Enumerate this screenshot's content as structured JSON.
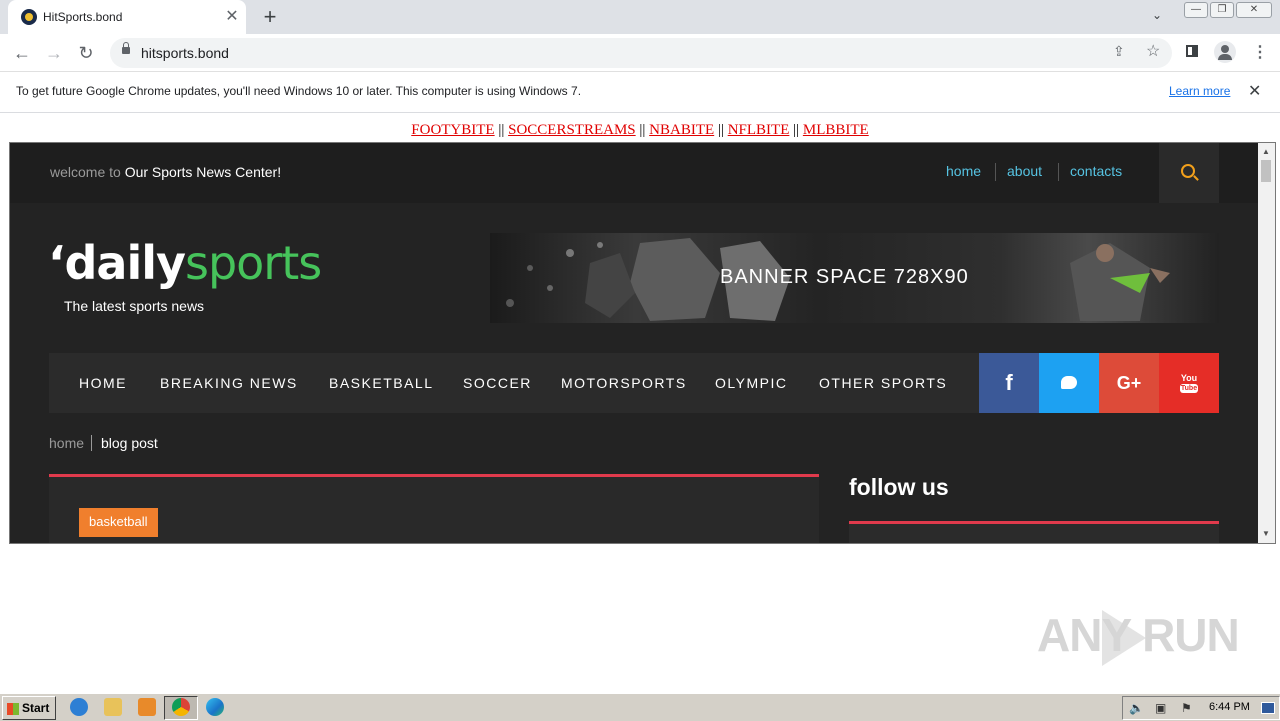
{
  "browser": {
    "tab_title": "HitSports.bond",
    "tab_close": "✕",
    "new_tab": "+",
    "url": "hitsports.bond",
    "window_controls": {
      "minimize": "—",
      "restore": "❐",
      "close": "✕"
    }
  },
  "infobar": {
    "message": "To get future Google Chrome updates, you'll need Windows 10 or later. This computer is using Windows 7.",
    "link": "Learn more",
    "close": "✕"
  },
  "page": {
    "top_links": [
      "FOOTYBITE",
      "SOCCERSTREAMS",
      "NBABITE",
      "NFLBITE",
      "MLBBITE"
    ],
    "top_links_separator": "||"
  },
  "site": {
    "welcome_prefix": "welcome to",
    "welcome_main": "Our Sports News Center!",
    "top_nav": [
      "home",
      "about",
      "contacts"
    ],
    "logo": {
      "mark": "‘",
      "part1": "daily",
      "part2": "sports"
    },
    "tagline": "The latest sports news",
    "banner_text": "BANNER SPACE 728X90",
    "main_nav": [
      "HOME",
      "BREAKING NEWS",
      "BASKETBALL",
      "SOCCER",
      "MOTORSPORTS",
      "OLYMPIC",
      "OTHER SPORTS"
    ],
    "social": {
      "facebook": "f",
      "google_plus": "G+",
      "youtube_top": "You",
      "youtube_bottom": "Tube"
    },
    "breadcrumb": {
      "home": "home",
      "current": "blog post"
    },
    "post_tag": "basketball",
    "sidebar_title": "follow us",
    "colors": {
      "accent_green": "#46c35b",
      "accent_red": "#e03a4c",
      "tag_orange": "#f07f2d",
      "link_blue": "#56c3e2",
      "facebook": "#3b5998",
      "twitter": "#1da1f2",
      "google_plus": "#dd4b39",
      "youtube": "#e52d27"
    }
  },
  "watermark": "ANY RUN",
  "taskbar": {
    "start": "Start",
    "clock": "6:44 PM"
  }
}
